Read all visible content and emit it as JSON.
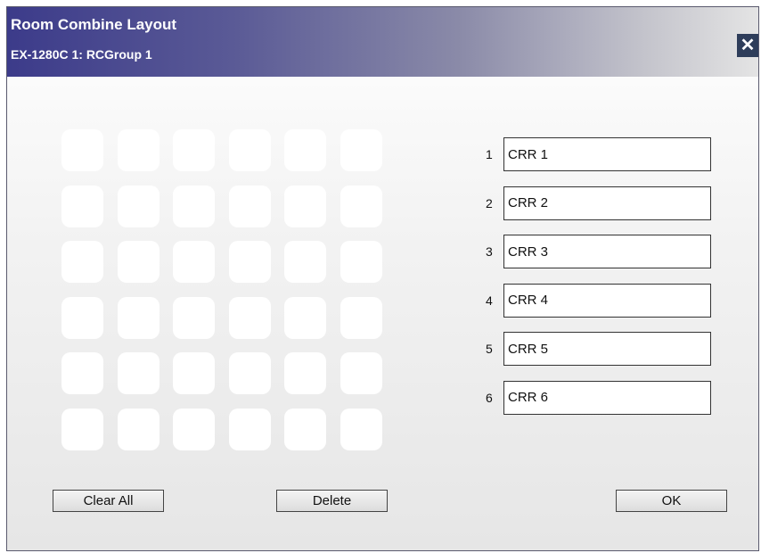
{
  "window": {
    "title": "Room Combine Layout",
    "subtitle": "EX-1280C 1: RCGroup 1",
    "close_glyph": "✕"
  },
  "layout_grid": {
    "rows": 6,
    "columns": 6
  },
  "rooms": [
    {
      "number": "1",
      "name": "CRR 1"
    },
    {
      "number": "2",
      "name": "CRR 2"
    },
    {
      "number": "3",
      "name": "CRR 3"
    },
    {
      "number": "4",
      "name": "CRR 4"
    },
    {
      "number": "5",
      "name": "CRR 5"
    },
    {
      "number": "6",
      "name": "CRR 6"
    }
  ],
  "buttons": {
    "clear_all": "Clear All",
    "delete": "Delete",
    "ok": "OK"
  },
  "colors": {
    "title_gradient_start": "#3c3b8a",
    "title_gradient_end": "#e4e4e4",
    "close_button": "#2e3d5a",
    "cell_fill": "#ffffff"
  }
}
